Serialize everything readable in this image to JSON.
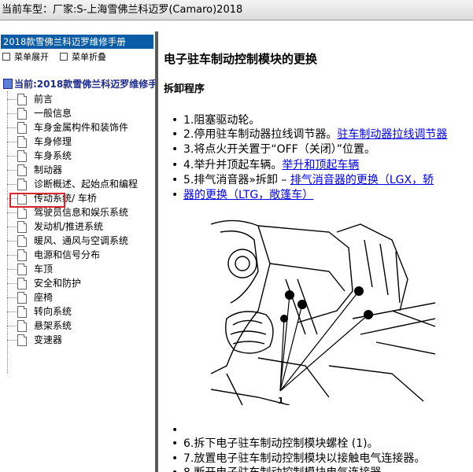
{
  "header": {
    "prefix": "当前车型：",
    "vehicle": "厂家:S-上海雪佛兰科迈罗(Camaro)2018"
  },
  "sidebar": {
    "title": "2018款雪佛兰科迈罗维修手册",
    "expand_label": "菜单展开",
    "collapse_label": "菜单折叠",
    "root_label": "当前:2018款雪佛兰科迈罗维修手册",
    "items": [
      {
        "label": "前言"
      },
      {
        "label": "一般信息"
      },
      {
        "label": "车身金属构件和装饰件"
      },
      {
        "label": "车身修理"
      },
      {
        "label": "车身系统"
      },
      {
        "label": "制动器",
        "selected": true
      },
      {
        "label": "诊断概述、起始点和编程"
      },
      {
        "label": "传动系统/ 车桥"
      },
      {
        "label": "驾驶员信息和娱乐系统"
      },
      {
        "label": "发动机/推进系统"
      },
      {
        "label": "暖风、通风与空调系统"
      },
      {
        "label": "电源和信号分布"
      },
      {
        "label": "车顶"
      },
      {
        "label": "安全和防护"
      },
      {
        "label": "座椅"
      },
      {
        "label": "转向系统"
      },
      {
        "label": "悬架系统"
      },
      {
        "label": "变速器"
      }
    ],
    "highlight_color": "#d9262b"
  },
  "content": {
    "title": "电子驻车制动控制模块的更换",
    "subtitle": "拆卸程序",
    "steps": {
      "s1": "1.阻塞驱动轮。",
      "s2_text": "2.停用驻车制动器拉线调节器。",
      "s2_link": "驻车制动器拉线调节器",
      "s3": "3.将点火开关置于“OFF（关闭）”位置。",
      "s4_text": "4.举升并顶起车辆。",
      "s4_link": "举升和顶起车辆",
      "s5_text": "5.排气消音器»拆卸 – ",
      "s5_link1": "排气消音器的更换（LGX，轿",
      "s5_link2": "器的更换（LTG，敞篷车）",
      "s6": "6.拆下电子驻车制动控制模块螺栓 (1)。",
      "s7": "7.放置电子驻车制动控制模块以接触电气连接器。",
      "s8": "8.断开电子驻车制动控制模块电气连接器。"
    },
    "figure_callout": "1",
    "link_color": "#0000ee"
  }
}
